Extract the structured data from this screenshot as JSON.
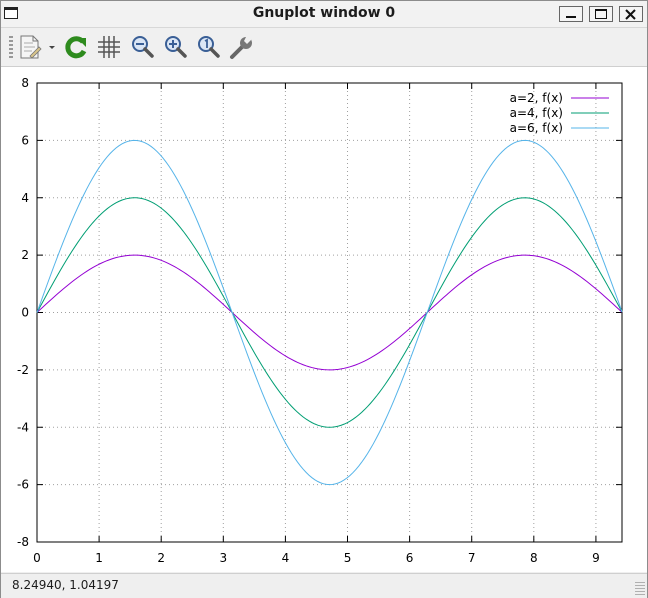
{
  "window": {
    "title": "Gnuplot window 0"
  },
  "toolbar": {
    "icons": [
      "copy-to-clipboard-icon",
      "replot-icon",
      "grid-icon",
      "zoom-out-icon",
      "zoom-in-icon",
      "zoom-reset-icon",
      "settings-icon"
    ]
  },
  "status": {
    "text": "8.24940,  1.04197"
  },
  "colors": {
    "a2": "#9400d3",
    "a4": "#009e73",
    "a6": "#56b4e9",
    "grid": "#a0a0a0"
  },
  "chart_data": {
    "type": "line",
    "title": "",
    "xlabel": "",
    "ylabel": "",
    "xlim": [
      0,
      9.42
    ],
    "ylim": [
      -8,
      8
    ],
    "xticks": [
      0,
      1,
      2,
      3,
      4,
      5,
      6,
      7,
      8,
      9
    ],
    "yticks": [
      8,
      6,
      4,
      2,
      0,
      -2,
      -4,
      -6,
      -8
    ],
    "grid": true,
    "legend_position": "top-right",
    "function": "a*sin(x)",
    "series": [
      {
        "name": "a=2, f(x)",
        "amplitude": 2,
        "color": "#9400d3"
      },
      {
        "name": "a=4, f(x)",
        "amplitude": 4,
        "color": "#009e73"
      },
      {
        "name": "a=6, f(x)",
        "amplitude": 6,
        "color": "#56b4e9"
      }
    ]
  }
}
